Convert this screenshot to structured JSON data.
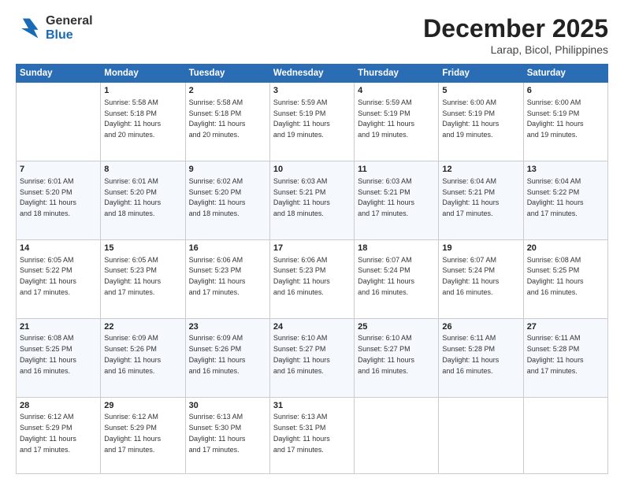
{
  "header": {
    "logo_general": "General",
    "logo_blue": "Blue",
    "month_title": "December 2025",
    "location": "Larap, Bicol, Philippines"
  },
  "days_of_week": [
    "Sunday",
    "Monday",
    "Tuesday",
    "Wednesday",
    "Thursday",
    "Friday",
    "Saturday"
  ],
  "weeks": [
    [
      {
        "day": "",
        "info": ""
      },
      {
        "day": "1",
        "info": "Sunrise: 5:58 AM\nSunset: 5:18 PM\nDaylight: 11 hours\nand 20 minutes."
      },
      {
        "day": "2",
        "info": "Sunrise: 5:58 AM\nSunset: 5:18 PM\nDaylight: 11 hours\nand 20 minutes."
      },
      {
        "day": "3",
        "info": "Sunrise: 5:59 AM\nSunset: 5:19 PM\nDaylight: 11 hours\nand 19 minutes."
      },
      {
        "day": "4",
        "info": "Sunrise: 5:59 AM\nSunset: 5:19 PM\nDaylight: 11 hours\nand 19 minutes."
      },
      {
        "day": "5",
        "info": "Sunrise: 6:00 AM\nSunset: 5:19 PM\nDaylight: 11 hours\nand 19 minutes."
      },
      {
        "day": "6",
        "info": "Sunrise: 6:00 AM\nSunset: 5:19 PM\nDaylight: 11 hours\nand 19 minutes."
      }
    ],
    [
      {
        "day": "7",
        "info": "Sunrise: 6:01 AM\nSunset: 5:20 PM\nDaylight: 11 hours\nand 18 minutes."
      },
      {
        "day": "8",
        "info": "Sunrise: 6:01 AM\nSunset: 5:20 PM\nDaylight: 11 hours\nand 18 minutes."
      },
      {
        "day": "9",
        "info": "Sunrise: 6:02 AM\nSunset: 5:20 PM\nDaylight: 11 hours\nand 18 minutes."
      },
      {
        "day": "10",
        "info": "Sunrise: 6:03 AM\nSunset: 5:21 PM\nDaylight: 11 hours\nand 18 minutes."
      },
      {
        "day": "11",
        "info": "Sunrise: 6:03 AM\nSunset: 5:21 PM\nDaylight: 11 hours\nand 17 minutes."
      },
      {
        "day": "12",
        "info": "Sunrise: 6:04 AM\nSunset: 5:21 PM\nDaylight: 11 hours\nand 17 minutes."
      },
      {
        "day": "13",
        "info": "Sunrise: 6:04 AM\nSunset: 5:22 PM\nDaylight: 11 hours\nand 17 minutes."
      }
    ],
    [
      {
        "day": "14",
        "info": "Sunrise: 6:05 AM\nSunset: 5:22 PM\nDaylight: 11 hours\nand 17 minutes."
      },
      {
        "day": "15",
        "info": "Sunrise: 6:05 AM\nSunset: 5:23 PM\nDaylight: 11 hours\nand 17 minutes."
      },
      {
        "day": "16",
        "info": "Sunrise: 6:06 AM\nSunset: 5:23 PM\nDaylight: 11 hours\nand 17 minutes."
      },
      {
        "day": "17",
        "info": "Sunrise: 6:06 AM\nSunset: 5:23 PM\nDaylight: 11 hours\nand 16 minutes."
      },
      {
        "day": "18",
        "info": "Sunrise: 6:07 AM\nSunset: 5:24 PM\nDaylight: 11 hours\nand 16 minutes."
      },
      {
        "day": "19",
        "info": "Sunrise: 6:07 AM\nSunset: 5:24 PM\nDaylight: 11 hours\nand 16 minutes."
      },
      {
        "day": "20",
        "info": "Sunrise: 6:08 AM\nSunset: 5:25 PM\nDaylight: 11 hours\nand 16 minutes."
      }
    ],
    [
      {
        "day": "21",
        "info": "Sunrise: 6:08 AM\nSunset: 5:25 PM\nDaylight: 11 hours\nand 16 minutes."
      },
      {
        "day": "22",
        "info": "Sunrise: 6:09 AM\nSunset: 5:26 PM\nDaylight: 11 hours\nand 16 minutes."
      },
      {
        "day": "23",
        "info": "Sunrise: 6:09 AM\nSunset: 5:26 PM\nDaylight: 11 hours\nand 16 minutes."
      },
      {
        "day": "24",
        "info": "Sunrise: 6:10 AM\nSunset: 5:27 PM\nDaylight: 11 hours\nand 16 minutes."
      },
      {
        "day": "25",
        "info": "Sunrise: 6:10 AM\nSunset: 5:27 PM\nDaylight: 11 hours\nand 16 minutes."
      },
      {
        "day": "26",
        "info": "Sunrise: 6:11 AM\nSunset: 5:28 PM\nDaylight: 11 hours\nand 16 minutes."
      },
      {
        "day": "27",
        "info": "Sunrise: 6:11 AM\nSunset: 5:28 PM\nDaylight: 11 hours\nand 17 minutes."
      }
    ],
    [
      {
        "day": "28",
        "info": "Sunrise: 6:12 AM\nSunset: 5:29 PM\nDaylight: 11 hours\nand 17 minutes."
      },
      {
        "day": "29",
        "info": "Sunrise: 6:12 AM\nSunset: 5:29 PM\nDaylight: 11 hours\nand 17 minutes."
      },
      {
        "day": "30",
        "info": "Sunrise: 6:13 AM\nSunset: 5:30 PM\nDaylight: 11 hours\nand 17 minutes."
      },
      {
        "day": "31",
        "info": "Sunrise: 6:13 AM\nSunset: 5:31 PM\nDaylight: 11 hours\nand 17 minutes."
      },
      {
        "day": "",
        "info": ""
      },
      {
        "day": "",
        "info": ""
      },
      {
        "day": "",
        "info": ""
      }
    ]
  ]
}
